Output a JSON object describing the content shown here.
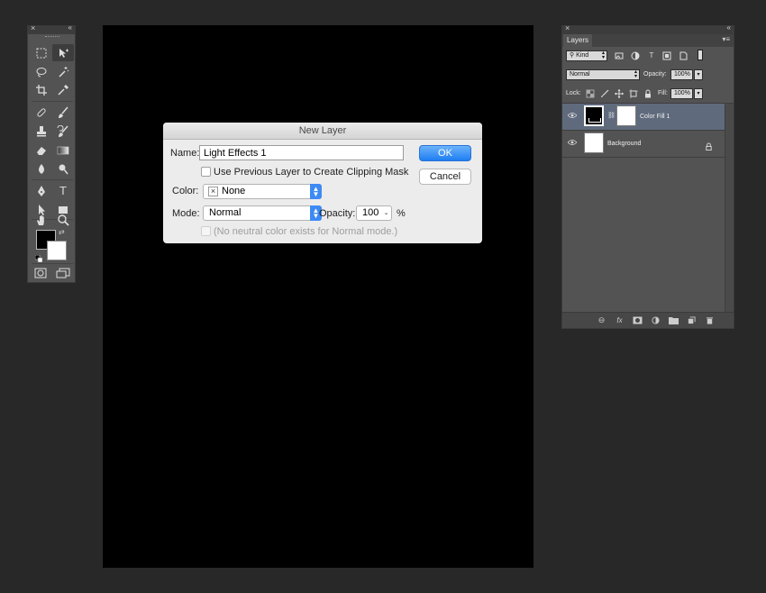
{
  "toolbox": {
    "tools": [
      "marquee-tool-icon",
      "move-tool-icon",
      "lasso-tool-icon",
      "magic-wand-icon",
      "crop-tool-icon",
      "eyedropper-icon",
      "healing-brush-icon",
      "brush-icon",
      "clone-stamp-icon",
      "history-brush-icon",
      "eraser-icon",
      "gradient-icon",
      "blur-icon",
      "dodge-icon",
      "pen-tool-icon",
      "type-tool-icon",
      "path-selection-icon",
      "rectangle-tool-icon",
      "hand-tool-icon",
      "zoom-tool-icon"
    ],
    "type_tool_glyph": "T",
    "foreground_color": "#000000",
    "background_color": "#ffffff"
  },
  "dialog": {
    "title": "New Layer",
    "name_label": "Name:",
    "name_value": "Light Effects 1",
    "clipping_checkbox_label": "Use Previous Layer to Create Clipping Mask",
    "color_label": "Color:",
    "color_value": "None",
    "color_none_glyph": "×",
    "mode_label": "Mode:",
    "mode_value": "Normal",
    "opacity_label": "Opacity:",
    "opacity_value": "100",
    "opacity_unit": "%",
    "neutral_label": "(No neutral color exists for Normal mode.)",
    "ok_label": "OK",
    "cancel_label": "Cancel",
    "accent_color": "#1f7ef2"
  },
  "layers_panel": {
    "tab_label": "Layers",
    "filter_label": "Kind",
    "blend_mode": "Normal",
    "opacity_label": "Opacity:",
    "opacity_value": "100%",
    "lock_label": "Lock:",
    "fill_label": "Fill:",
    "fill_value": "100%",
    "layers": [
      {
        "name": "Color Fill 1",
        "selected": true,
        "visible": true
      },
      {
        "name": "Background",
        "selected": false,
        "visible": true,
        "locked": true
      }
    ],
    "bottom_icons": [
      "link-layers-icon",
      "fx-icon",
      "add-mask-icon",
      "adjustment-layer-icon",
      "new-group-icon",
      "new-layer-icon",
      "trash-icon"
    ],
    "fx_glyph": "fx"
  }
}
